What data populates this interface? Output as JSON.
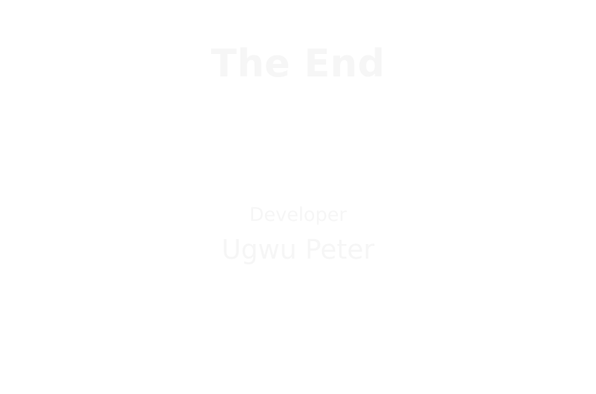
{
  "ending_screen": {
    "title": "The End",
    "credit_label": "Developer",
    "credit_name": "Ugwu Peter",
    "text_color": "#f6f6f6",
    "background_color": "#ffffff"
  }
}
